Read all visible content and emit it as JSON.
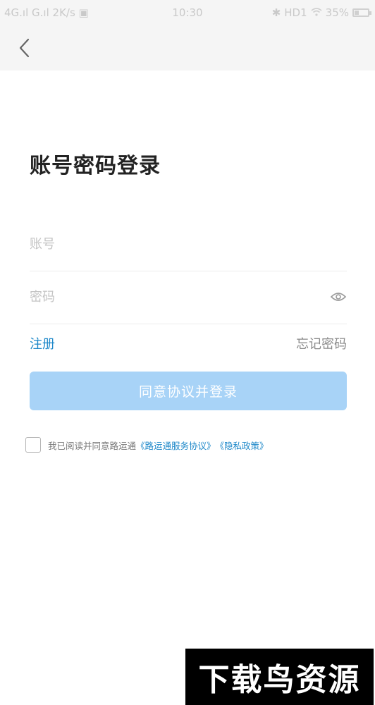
{
  "status_bar": {
    "signal_left": "4G.ıl G.ıl",
    "speed": "2K/s",
    "time": "10:30",
    "right_text": "HD1",
    "battery_text": "35%",
    "battery_level": 0.35,
    "icons": [
      "signal-icon",
      "bluetooth-icon",
      "wifi-icon",
      "battery-icon"
    ]
  },
  "header": {
    "back_icon": "chevron-left-icon"
  },
  "title": "账号密码登录",
  "form": {
    "account_placeholder": "账号",
    "account_value": "",
    "password_placeholder": "密码",
    "password_value": "",
    "password_toggle_icon": "eye-icon"
  },
  "links": {
    "register": "注册",
    "forgot_password": "忘记密码"
  },
  "login_button": {
    "label": "同意协议并登录",
    "color": "#a8d3f7"
  },
  "agreement": {
    "checked": false,
    "prefix": "我已阅读并同意路运通",
    "service_link": "《路运通服务协议》",
    "privacy_link": "《隐私政策》"
  },
  "watermark": "下载鸟资源",
  "colors": {
    "accent": "#1e88c9",
    "button_disabled": "#a8d3f7",
    "header_bg": "#f5f5f5"
  }
}
